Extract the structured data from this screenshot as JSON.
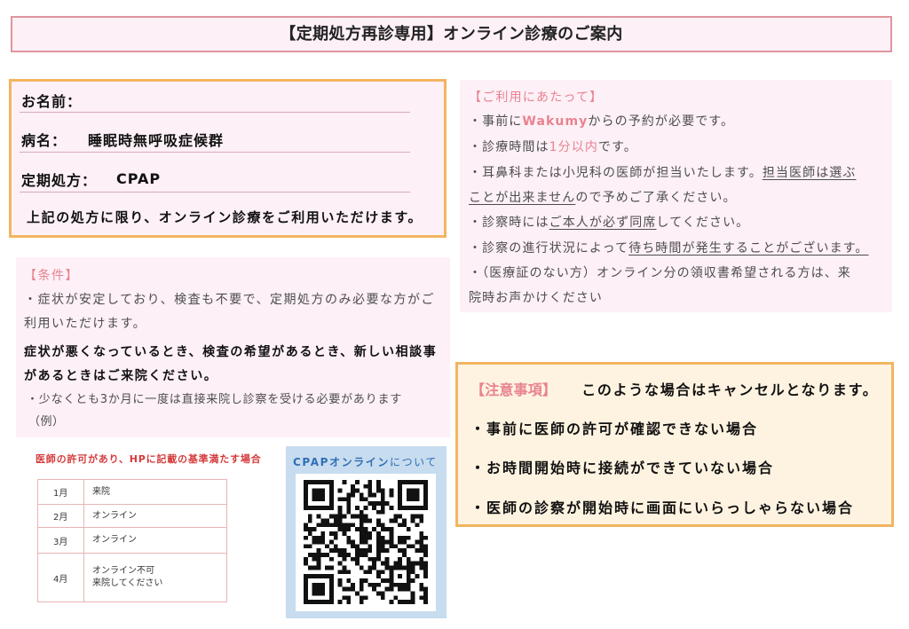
{
  "document": {
    "title": "【定期処方再診専用】オンライン診療のご案内"
  },
  "patient": {
    "name_label": "お名前：",
    "diagnosis_label": "病名：",
    "diagnosis_value": "睡眠時無呼吸症候群",
    "prescription_label": "定期処方：",
    "prescription_value": "CPAP",
    "note": "上記の処方に限り、オンライン診療をご利用いただけます。"
  },
  "conditions": {
    "heading": "【条件】",
    "line1": "・症状が安定しており、検査も不要で、定期処方のみ必要な方がご",
    "line2": "利用いただけます。",
    "bold1": "症状が悪くなっているとき、検査の希望があるとき、新しい相談事",
    "bold2": "があるときはご来院ください。",
    "note": "・少なくとも3か月に一度は直接来院し診察を受ける必要があります",
    "example": "（例）"
  },
  "schedule": {
    "heading": "医師の許可があり、HPに記載の基準満たす場合",
    "rows": [
      {
        "month": "1月",
        "status": [
          "来院"
        ]
      },
      {
        "month": "2月",
        "status": [
          "オンライン"
        ]
      },
      {
        "month": "3月",
        "status": [
          "オンライン"
        ]
      },
      {
        "month": "4月",
        "status": [
          "オンライン不可",
          "来院してください"
        ]
      }
    ]
  },
  "qr": {
    "title_bold": "CPAPオンライン",
    "title_rest": "について"
  },
  "usage": {
    "heading": "【ご利用にあたって】",
    "lines": [
      [
        "・事前に",
        "Wakumy",
        "からの予約が必要です。"
      ],
      [
        "・診療時間は",
        "1分以内",
        "です。"
      ],
      [
        "・耳鼻科または小児科の医師が担当いたします。",
        "担当医師は選ぶ"
      ],
      [
        "ことが出来ません",
        "ので予めご了承ください。"
      ],
      [
        "・診察時には",
        "ご本人が必ず同席",
        "してください。"
      ],
      [
        "・診察の進行状況によって",
        "待ち時間が発生することがございます。"
      ],
      [
        "・（医療証のない方）オンライン分の領収書希望される方は、来"
      ],
      [
        "院時お声かけください"
      ]
    ]
  },
  "caution": {
    "tag": "【注意事項】",
    "headline": "このような場合はキャンセルとなります。",
    "items": [
      "・事前に医師の許可が確認できない場合",
      "・お時間開始時に接続ができていない場合",
      "・医師の診察が開始時に画面にいらっしゃらない場合"
    ]
  },
  "colors": {
    "accent_pink": "#e8838f",
    "title_border": "#e0959d",
    "panel_pink": "#fdf0f7",
    "border_orange": "#f2b561",
    "caution_bg": "#fef3e1",
    "qr_bg": "#c7dcef",
    "qr_blue": "#2e6fb6",
    "schedule_red": "#d43b3b",
    "table_border": "#e9b4b4"
  }
}
